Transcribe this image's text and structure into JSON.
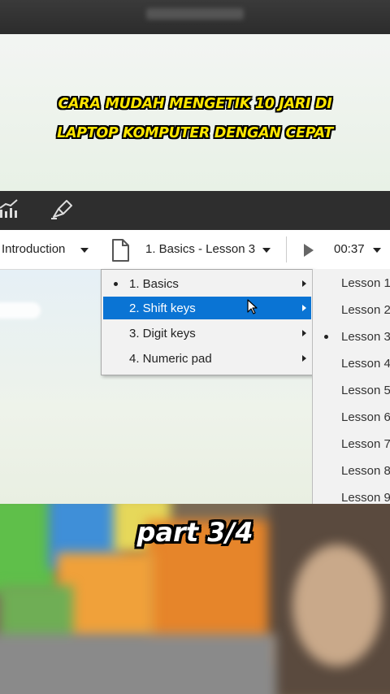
{
  "headline": {
    "line1": "CARA MUDAH MENGETIK 10 JARI DI",
    "line2": "LAPTOP KOMPUTER DENGAN CEPAT"
  },
  "toolbar": {
    "mode_label": "Introduction",
    "lesson_label": "1. Basics - Lesson 3",
    "timer": "00:37"
  },
  "menu": {
    "items": [
      {
        "label": "1. Basics"
      },
      {
        "label": "2. Shift keys"
      },
      {
        "label": "3. Digit keys"
      },
      {
        "label": "4. Numeric pad"
      }
    ]
  },
  "submenu": {
    "items": [
      {
        "label": "Lesson 1"
      },
      {
        "label": "Lesson 2"
      },
      {
        "label": "Lesson 3"
      },
      {
        "label": "Lesson 4"
      },
      {
        "label": "Lesson 5"
      },
      {
        "label": "Lesson 6"
      },
      {
        "label": "Lesson 7"
      },
      {
        "label": "Lesson 8"
      },
      {
        "label": "Lesson 9"
      }
    ]
  },
  "caption": "part  3/4",
  "colors": {
    "accent": "#0a74d4",
    "headline": "#ffe600"
  }
}
